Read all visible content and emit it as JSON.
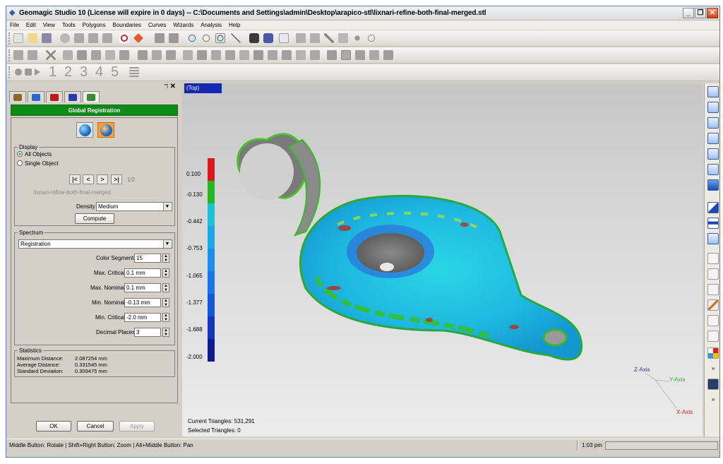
{
  "window": {
    "title": "Geomagic Studio 10 (License will expire in 0 days) -- C:\\Documents and Settings\\admin\\Desktop\\arapico-stl\\lixnari-refine-both-final-merged.stl",
    "minimize": "_",
    "restore": "❐",
    "close": "✕"
  },
  "menu": [
    "File",
    "Edit",
    "View",
    "Tools",
    "Polygons",
    "Boundaries",
    "Curves",
    "Wizards",
    "Analysis",
    "Help"
  ],
  "toolbar3": {
    "numbers": [
      "1",
      "2",
      "3",
      "4",
      "5"
    ]
  },
  "panel": {
    "pin": "ℸ",
    "close": "✕",
    "header": "Global Registration",
    "display": {
      "legend": "Display",
      "all_objects": "All Objects",
      "single_object": "Single Object",
      "nav_first": "|<",
      "nav_prev": "<",
      "nav_next": ">",
      "nav_last": ">|",
      "page": "1/2",
      "object_name": "lixnari-refine-both-final-merged",
      "density_label": "Density",
      "density_value": "Medium",
      "compute": "Compute"
    },
    "spectrum": {
      "legend": "Spectrum",
      "type": "Registration",
      "fields": [
        {
          "label": "Color Segments",
          "value": "15"
        },
        {
          "label": "Max. Critical",
          "value": "0.1 mm"
        },
        {
          "label": "Max. Nominal",
          "value": "0.1 mm"
        },
        {
          "label": "Min. Nominal",
          "value": "-0.13 mm"
        },
        {
          "label": "Min. Critical",
          "value": "-2.0 mm"
        },
        {
          "label": "Decimal Places",
          "value": "3"
        }
      ]
    },
    "statistics": {
      "legend": "Statistics",
      "rows": [
        {
          "label": "Maximum Distance:",
          "value": "2.087254 mm"
        },
        {
          "label": "Average Distance:",
          "value": "0.331545 mm"
        },
        {
          "label": "Standard Deviation:",
          "value": "0.309475 mm"
        }
      ]
    },
    "ok": "OK",
    "cancel": "Cancel",
    "apply": "Apply"
  },
  "viewport": {
    "view_name": "(Top)",
    "scale_labels": [
      "0.100",
      "-0.130",
      "-0.442",
      "-0.753",
      "-1.065",
      "-1.377",
      "-1.688",
      "-2.000"
    ],
    "scale_colors": [
      "#d81a1a",
      "#22b822",
      "#1ec0d8",
      "#1ca8e4",
      "#1a90ec",
      "#1874e8",
      "#1456d8",
      "#1038b8",
      "#0c1c8c"
    ],
    "current_triangles": "Current Triangles: 531,291",
    "selected_triangles": "Selected Triangles: 0",
    "axes": {
      "z": "Z-Axis",
      "y": "Y-Axis",
      "x": "X-Axis"
    }
  },
  "statusbar": {
    "hint": "Middle Button: Rotate | Shift+Right Button: Zoom | Alt+Middle Button: Pan",
    "time": "1:03 pm"
  }
}
